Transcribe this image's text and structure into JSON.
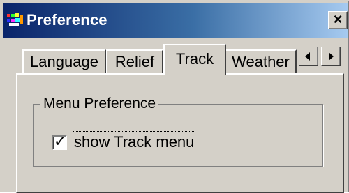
{
  "window": {
    "title": "Preference",
    "close_glyph": "×",
    "app_icon": "app-logo-icon"
  },
  "tabs": [
    {
      "label": "Language",
      "selected": false
    },
    {
      "label": "Relief",
      "selected": false
    },
    {
      "label": "Track",
      "selected": true
    },
    {
      "label": "Weather",
      "selected": false
    }
  ],
  "tab_scroll": {
    "left_icon": "arrow-left-icon",
    "right_icon": "arrow-right-icon"
  },
  "group": {
    "label": "Menu Preference",
    "checkbox": {
      "label": "show Track menu",
      "checked": true,
      "check_glyph": "✓"
    }
  },
  "colors": {
    "titlebar_start": "#0a246a",
    "titlebar_end": "#a6caf0",
    "face": "#d4d0c8"
  }
}
